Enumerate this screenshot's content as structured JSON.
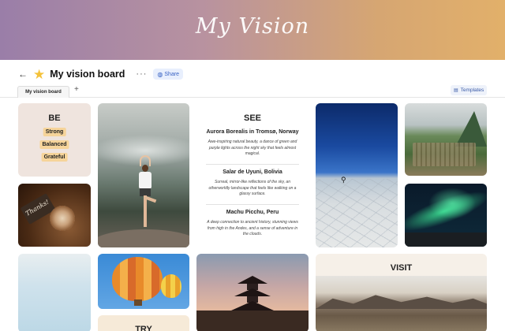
{
  "banner": {
    "title": "My Vision"
  },
  "header": {
    "title": "My vision board",
    "share_label": "Share",
    "more_label": "···"
  },
  "tabs": {
    "active_label": "My vision board",
    "add_label": "+",
    "templates_label": "Templates"
  },
  "cards": {
    "be": {
      "title": "BE",
      "words": [
        "Strong",
        "Balanced",
        "Grateful"
      ]
    },
    "coffee": {
      "note": "Thanks!"
    },
    "see": {
      "title": "SEE",
      "items": [
        {
          "title": "Aurora Borealis in Tromsø, Norway",
          "desc": "Awe-inspiring natural beauty, a dance of green and purple lights across the night sky that feels almost magical."
        },
        {
          "title": "Salar de Uyuni, Bolivia",
          "desc": "Surreal, mirror-like reflections of the sky, an otherworldly landscape that feels like walking on a glassy surface."
        },
        {
          "title": "Machu Picchu, Peru",
          "desc": "A deep connection to ancient history, stunning views from high in the Andes, and a sense of adventure in the clouds."
        }
      ]
    },
    "try": {
      "title": "TRY"
    },
    "visit": {
      "title": "VISIT"
    }
  },
  "colors": {
    "banner_start": "#9a7ea8",
    "banner_end": "#e2b06a",
    "share_bg": "#e8effd",
    "pill": "#f6d49a"
  },
  "icons": {
    "back": "arrow-left-icon",
    "star": "star-icon",
    "globe": "globe-icon",
    "templates": "template-icon"
  }
}
